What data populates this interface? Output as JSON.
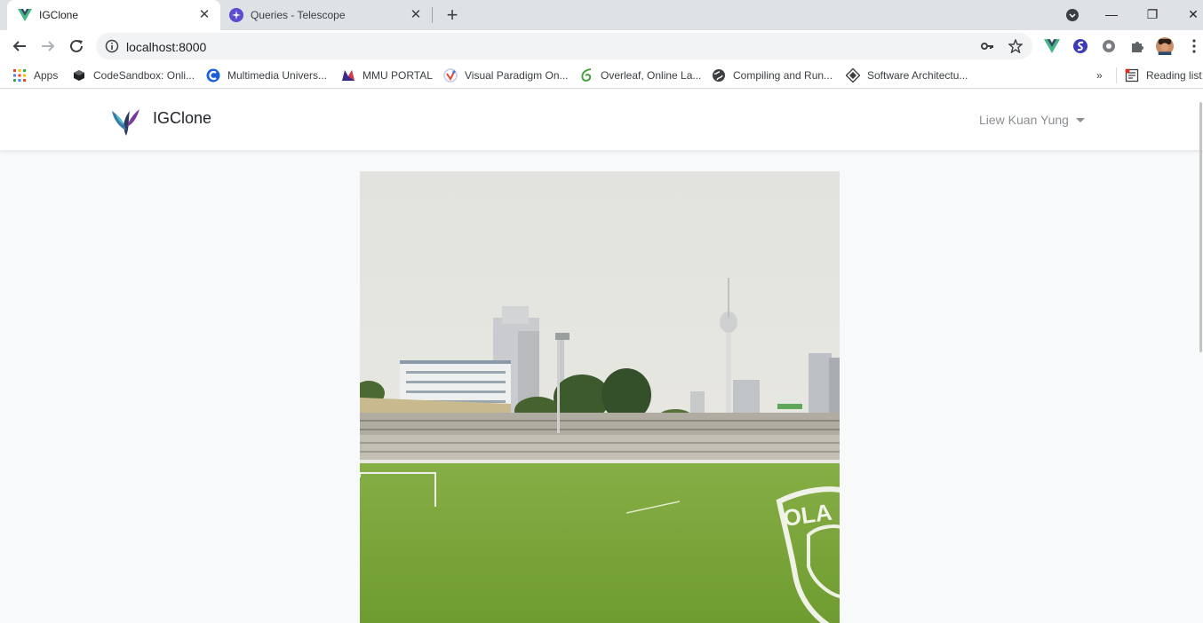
{
  "browser": {
    "tabs": [
      {
        "title": "IGClone",
        "close": "✕"
      },
      {
        "title": "Queries - Telescope",
        "close": "✕"
      }
    ],
    "new_tab": "+",
    "window_controls": {
      "minimize": "—",
      "maximize": "❐",
      "close": "✕"
    },
    "address": "localhost:8000",
    "bookmarks": [
      {
        "label": "Apps",
        "icon": "apps-grid-icon"
      },
      {
        "label": "CodeSandbox: Onli...",
        "icon": "codesandbox-icon"
      },
      {
        "label": "Multimedia Univers...",
        "icon": "mmu-icon"
      },
      {
        "label": "MMU PORTAL",
        "icon": "mmu-portal-icon"
      },
      {
        "label": "Visual Paradigm On...",
        "icon": "visual-paradigm-icon"
      },
      {
        "label": "Overleaf, Online La...",
        "icon": "overleaf-icon"
      },
      {
        "label": "Compiling and Run...",
        "icon": "globe-icon"
      },
      {
        "label": "Software Architectu...",
        "icon": "diamond-icon"
      }
    ],
    "overflow": "»",
    "reading_list": "Reading list"
  },
  "navbar": {
    "brand": "IGClone",
    "user_name": "Liew Kuan Yung"
  },
  "colors": {
    "accent_vue": "#41b883",
    "telescope": "#5b4dcf",
    "sky": "#e6e6e2",
    "grass": "#7fa83c"
  }
}
